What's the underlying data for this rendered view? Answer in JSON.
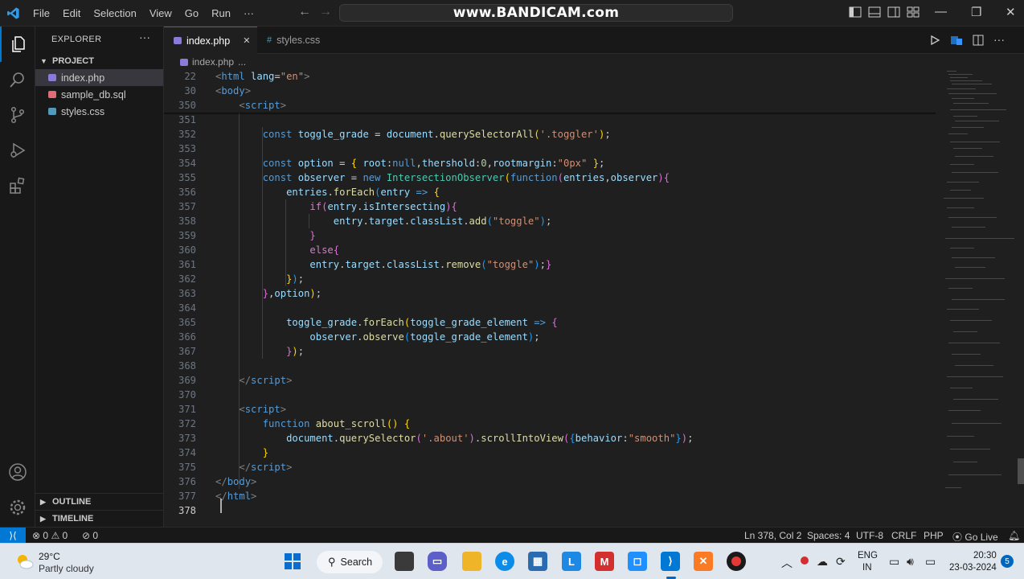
{
  "titlebar": {
    "menu": [
      "File",
      "Edit",
      "Selection",
      "View",
      "Go",
      "Run",
      "···"
    ],
    "watermark": "www.BANDICAM.com"
  },
  "sidebar": {
    "title": "EXPLORER",
    "more": "···",
    "project_label": "PROJECT",
    "files": [
      {
        "name": "index.php",
        "color": "#8b7bd8"
      },
      {
        "name": "sample_db.sql",
        "color": "#e06c75"
      },
      {
        "name": "styles.css",
        "color": "#519aba"
      }
    ],
    "outline_label": "OUTLINE",
    "timeline_label": "TIMELINE"
  },
  "tabs": [
    {
      "label": "index.php",
      "close": "✕"
    },
    {
      "label": "styles.css"
    }
  ],
  "breadcrumb": {
    "file": "index.php",
    "rest": "..."
  },
  "editor": {
    "line_numbers": [
      "22",
      "30",
      "350",
      "351",
      "352",
      "353",
      "354",
      "355",
      "356",
      "357",
      "358",
      "359",
      "360",
      "361",
      "362",
      "363",
      "364",
      "365",
      "366",
      "367",
      "368",
      "369",
      "370",
      "371",
      "372",
      "373",
      "374",
      "375",
      "376",
      "377",
      "378"
    ],
    "current_line": "378"
  },
  "statusbar": {
    "remote": "⟩⟨",
    "errors": "0",
    "warnings": "0",
    "ports": "0",
    "position": "Ln 378, Col 2",
    "spaces": "Spaces: 4",
    "encoding": "UTF-8",
    "eol": "CRLF",
    "language": "PHP",
    "golive": "Go Live"
  },
  "taskbar": {
    "temp": "29°C",
    "weather": "Partly cloudy",
    "search": "Search",
    "lang1": "ENG",
    "lang2": "IN",
    "time": "20:30",
    "date": "23-03-2024",
    "notif": "5"
  }
}
